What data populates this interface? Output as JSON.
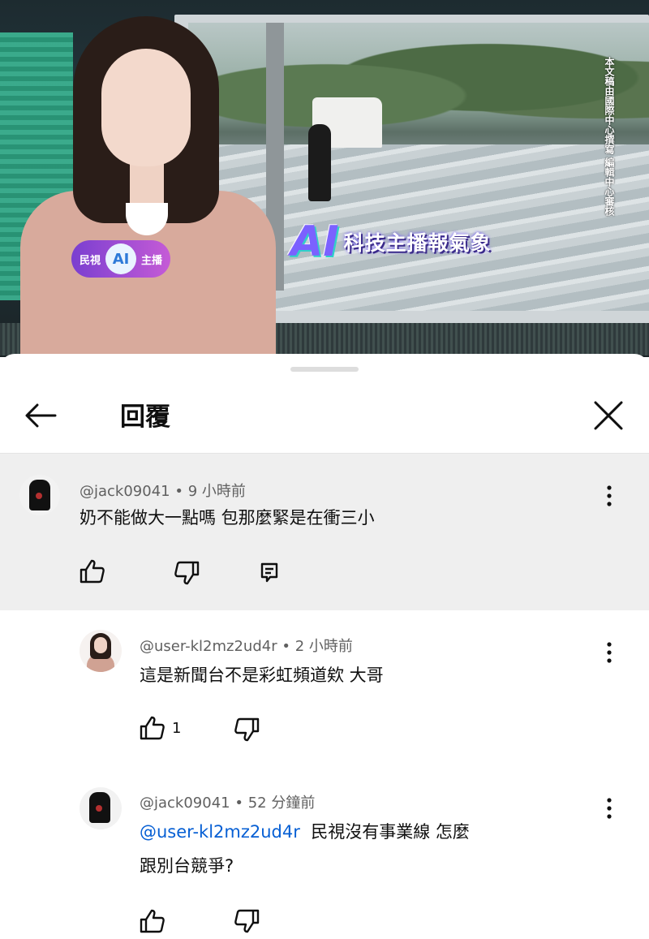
{
  "video": {
    "ai_badge_left": "民視",
    "ai_badge_center": "AI",
    "ai_badge_right": "主播",
    "title_ai": "AI",
    "title_text": "科技主播報氣象",
    "vertical_note": "本文稿由國際中心撰寫 編輯中心審核"
  },
  "header": {
    "title": "回覆",
    "back_icon": "arrow-left-icon",
    "close_icon": "close-icon"
  },
  "comments": [
    {
      "author": "@jack09041",
      "separator": "•",
      "time": "9 小時前",
      "text": "奶不能做大一點嗎 包那麼緊是在衝三小",
      "like_icon": "thumb-up-icon",
      "dislike_icon": "thumb-down-icon",
      "reply_icon": "comment-icon"
    },
    {
      "author": "@user-kl2mz2ud4r",
      "separator": "•",
      "time": "2 小時前",
      "text": "這是新聞台不是彩虹頻道欸 大哥",
      "likes": "1"
    },
    {
      "author": "@jack09041",
      "separator": "•",
      "time": "52 分鐘前",
      "mention": "@user-kl2mz2ud4r",
      "text_line1": "民視沒有事業線 怎麼",
      "text_line2": "跟別台競爭?"
    }
  ]
}
